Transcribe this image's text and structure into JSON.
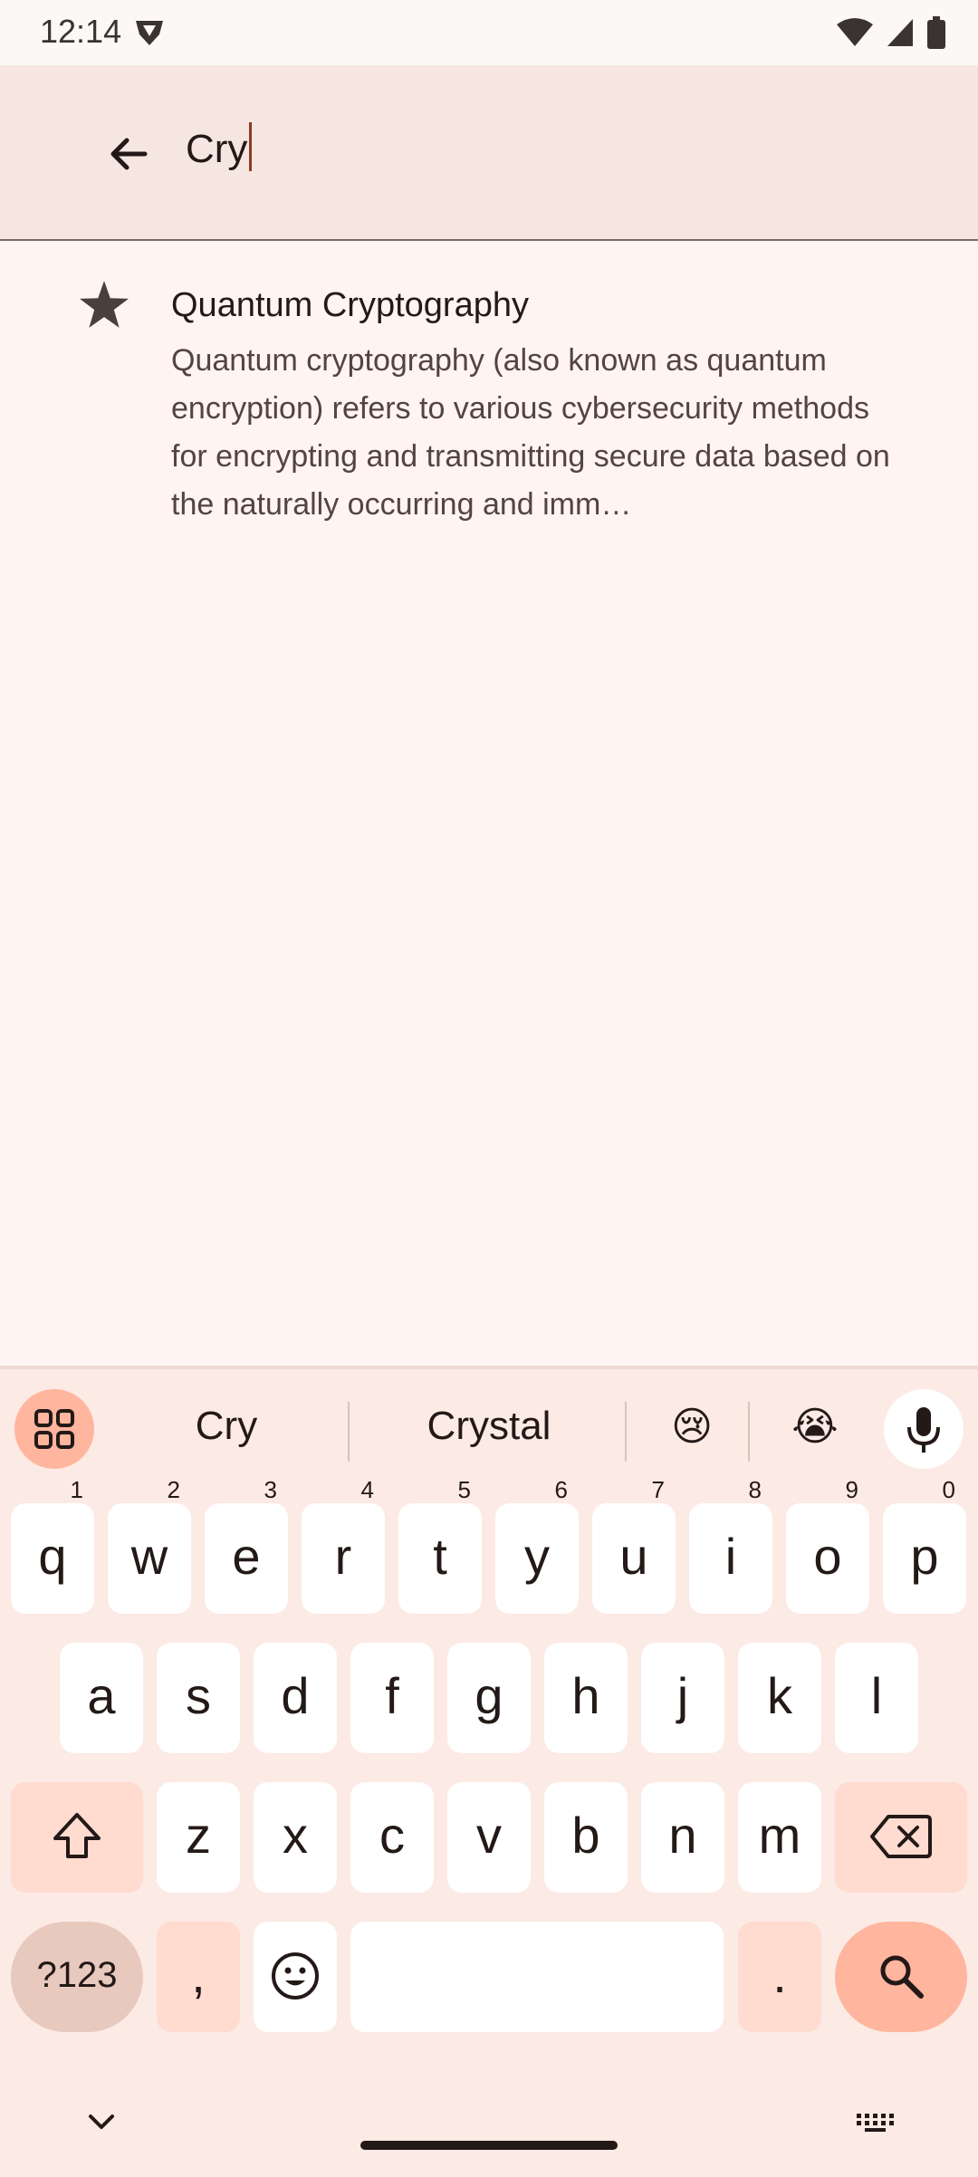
{
  "status_bar": {
    "time": "12:14"
  },
  "search": {
    "value": "Cry"
  },
  "result": {
    "title": "Quantum Cryptography",
    "description": "Quantum cryptography (also known as quantum encryption) refers to various cybersecurity methods for encrypting and transmitting secure data based on the naturally occurring and imm…"
  },
  "keyboard": {
    "suggestions": [
      "Cry",
      "Crystal",
      "😢",
      "😭"
    ],
    "row1": [
      {
        "key": "q",
        "hint": "1"
      },
      {
        "key": "w",
        "hint": "2"
      },
      {
        "key": "e",
        "hint": "3"
      },
      {
        "key": "r",
        "hint": "4"
      },
      {
        "key": "t",
        "hint": "5"
      },
      {
        "key": "y",
        "hint": "6"
      },
      {
        "key": "u",
        "hint": "7"
      },
      {
        "key": "i",
        "hint": "8"
      },
      {
        "key": "o",
        "hint": "9"
      },
      {
        "key": "p",
        "hint": "0"
      }
    ],
    "row2": [
      "a",
      "s",
      "d",
      "f",
      "g",
      "h",
      "j",
      "k",
      "l"
    ],
    "row3": [
      "z",
      "x",
      "c",
      "v",
      "b",
      "n",
      "m"
    ],
    "symbols_label": "?123",
    "comma": ",",
    "period": "."
  },
  "colors": {
    "background": "#FFF4F1",
    "search_bar": "#F6E6E1",
    "keyboard_bg": "#FCEAE5",
    "accent": "#FFB59E",
    "text": "#231917"
  }
}
